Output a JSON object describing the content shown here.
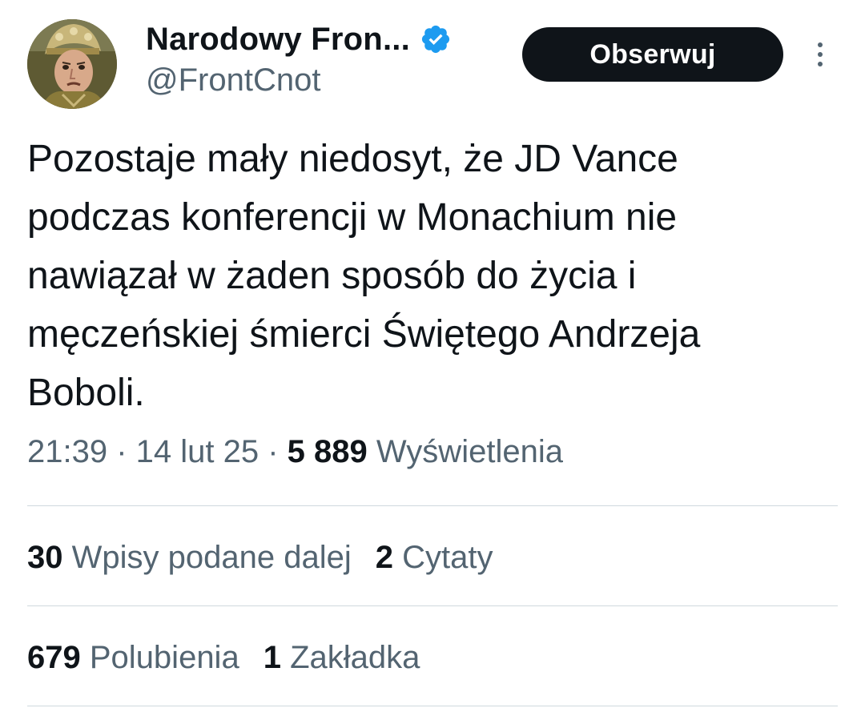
{
  "author": {
    "display_name": "Narodowy Fron...",
    "handle": "@FrontCnot",
    "verified": true
  },
  "follow_button": {
    "label": "Obserwuj"
  },
  "tweet": {
    "text": "Pozostaje mały niedosyt, że JD Vance\npodczas konferencji w Monachium nie\nnawiązał w żaden sposób do życia i\nmęczeńskiej śmierci Świętego Andrzeja\nBoboli."
  },
  "meta": {
    "time": "21:39",
    "sep1": " · ",
    "date": "14 lut 25",
    "sep2": " · ",
    "views_count": "5 889",
    "views_label": "Wyświetlenia"
  },
  "stats": {
    "reposts_count": "30",
    "reposts_label": "Wpisy podane dalej",
    "quotes_count": "2",
    "quotes_label": "Cytaty",
    "likes_count": "679",
    "likes_label": "Polubienia",
    "bookmarks_count": "1",
    "bookmarks_label": "Zakładka"
  },
  "colors": {
    "text_primary": "#0f1419",
    "text_secondary": "#536471",
    "divider": "#cfd9de",
    "verified_badge": "#1d9bf0",
    "button_bg": "#0f1419"
  },
  "icons": {
    "verified": "verified-badge-icon",
    "more": "more-vertical-icon"
  }
}
